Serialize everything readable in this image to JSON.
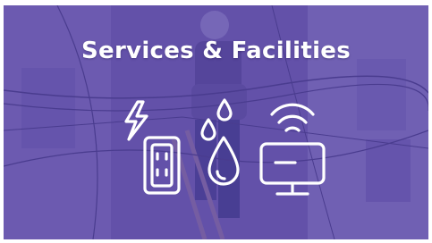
{
  "banner": {
    "title": "Services & Facilities",
    "overlay_color": "#5c46aa",
    "icon_color": "#ffffff"
  },
  "icons": [
    {
      "name": "electricity-icon",
      "description": "lightning bolt above power outlet"
    },
    {
      "name": "water-icon",
      "description": "water drops"
    },
    {
      "name": "internet-icon",
      "description": "wifi signal above computer monitor"
    }
  ]
}
